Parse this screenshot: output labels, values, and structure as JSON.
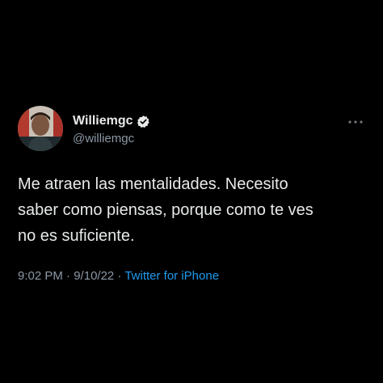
{
  "tweet": {
    "display_name": "Williemgc",
    "handle": "@williemgc",
    "text": "Me atraen las mentalidades. Necesito\nsaber como piensas, porque como te ves\nno es suficiente.",
    "time": "9:02 PM",
    "separator_1": " · ",
    "date": "9/10/22",
    "separator_2": " · ",
    "source": "Twitter for iPhone",
    "verified_icon": "verified-badge-icon",
    "more_icon": "more-options-icon"
  },
  "colors": {
    "background": "#000000",
    "primary_text": "#e7e9ea",
    "secondary_text": "#8b98a5",
    "link": "#1d9bf0"
  }
}
